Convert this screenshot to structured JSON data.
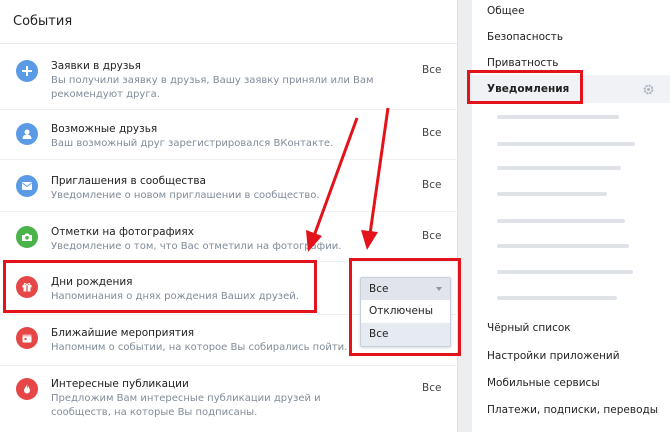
{
  "header": {
    "title": "События"
  },
  "rows": [
    {
      "title": "Заявки в друзья",
      "desc": "Вы получили заявку в друзья, Вашу заявку приняли или Вам рекомендуют друга.",
      "value": "Все",
      "color": "#5b9be6"
    },
    {
      "title": "Возможные друзья",
      "desc": "Ваш возможный друг зарегистрировался ВКонтакте.",
      "value": "Все",
      "color": "#5b9be6"
    },
    {
      "title": "Приглашения в сообщества",
      "desc": "Уведомление о новом приглашении в сообщество.",
      "value": "Все",
      "color": "#5b9be6"
    },
    {
      "title": "Отметки на фотографиях",
      "desc": "Уведомление о том, что Вас отметили на фотографии.",
      "value": "Все",
      "color": "#4bb34b"
    },
    {
      "title": "Дни рождения",
      "desc": "Напоминания о днях рождения Ваших друзей.",
      "value": "",
      "color": "#e64646"
    },
    {
      "title": "Ближайшие мероприятия",
      "desc": "Напомним о событии, на которое Вы собирались пойти.",
      "value": "",
      "color": "#e64646"
    },
    {
      "title": "Интересные публикации",
      "desc": "Предложим Вам интересные публикации друзей и сообществ, на которые Вы подписаны.",
      "value": "Все",
      "color": "#e64646"
    }
  ],
  "dropdown": {
    "selected": "Все",
    "options": [
      "Отключены",
      "Все"
    ]
  },
  "sidebar": {
    "items": [
      {
        "label": "Общее"
      },
      {
        "label": "Безопасность"
      },
      {
        "label": "Приватность"
      },
      {
        "label": "Уведомления",
        "active": true
      },
      {
        "label": "Чёрный список"
      },
      {
        "label": "Настройки приложений"
      },
      {
        "label": "Мобильные сервисы"
      },
      {
        "label": "Платежи, подписки, переводы"
      }
    ]
  },
  "colors": {
    "highlight": "#e3131b",
    "accent": "#5b9be6",
    "muted": "#818c99"
  }
}
